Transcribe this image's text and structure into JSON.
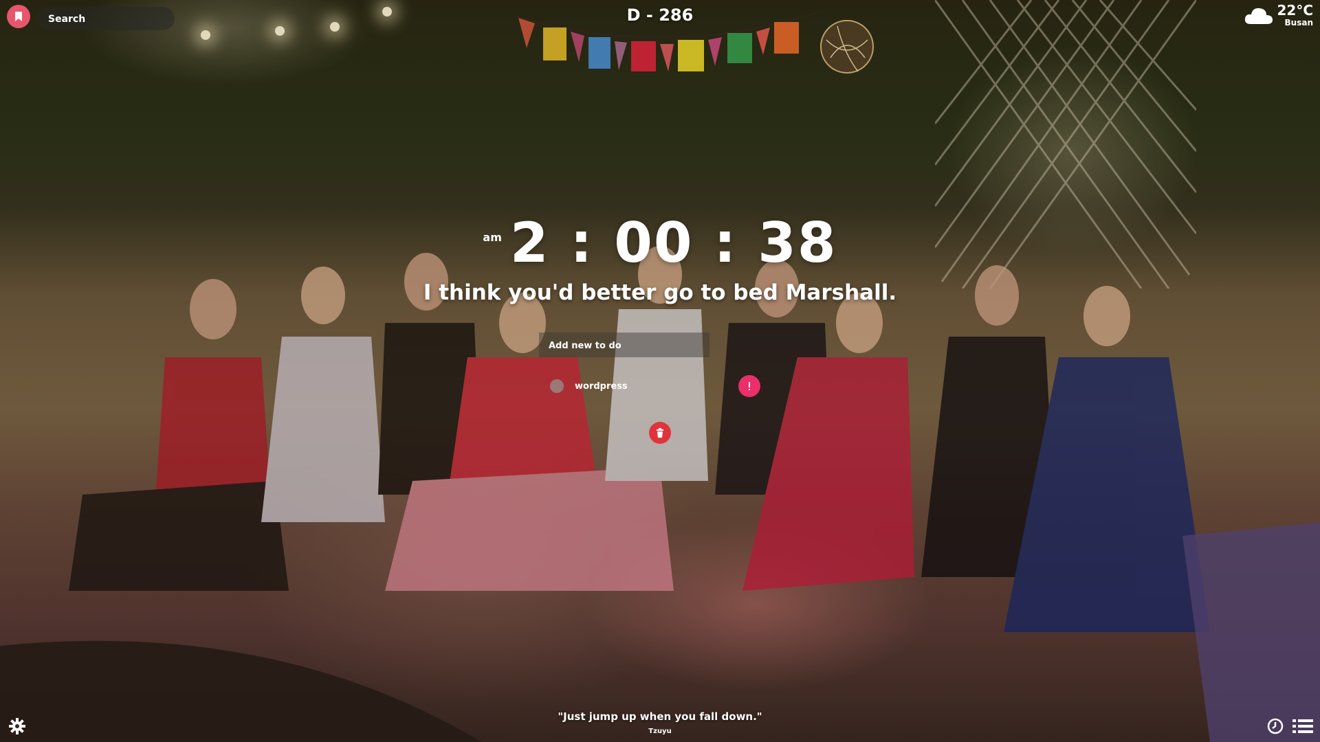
{
  "search": {
    "placeholder": "Search"
  },
  "header": {
    "dday": "D - 286"
  },
  "weather": {
    "temperature": "22°C",
    "city": "Busan",
    "icon": "cloud-icon"
  },
  "clock": {
    "ampm": "am",
    "time": "2 : 00 : 38"
  },
  "greeting": {
    "text": "I think you'd better go to bed Marshall."
  },
  "todo": {
    "input_placeholder": "Add new to do",
    "items": [
      {
        "label": "wordpress",
        "done": false
      }
    ]
  },
  "quote": {
    "text": "\"Just jump up when you fall down.\"",
    "author": "Tzuyu"
  },
  "icons": {
    "bookmark": "bookmark-icon",
    "important": "exclamation-icon",
    "delete": "trash-icon",
    "settings": "gear-icon",
    "clock": "clock-icon",
    "list": "list-icon"
  },
  "colors": {
    "bookmark_button": "#e8566e",
    "important_button": "#ea2f6a",
    "delete_button": "#e0343c",
    "text": "#ffffff"
  }
}
